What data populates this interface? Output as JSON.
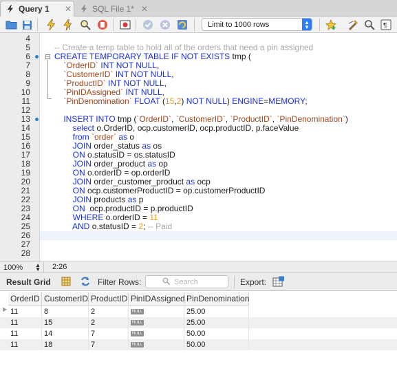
{
  "tabs": [
    {
      "label": "Query 1",
      "active": true,
      "close": "✕"
    },
    {
      "label": "SQL File 1*",
      "active": false,
      "close": "✕"
    }
  ],
  "toolbar": {
    "limit_value": "Limit to 1000 rows",
    "icons": [
      "folder-open-icon",
      "save-icon",
      "execute-icon",
      "execute-current-icon",
      "explain-icon",
      "stop-icon",
      "toggle-error-icon",
      "commit-icon",
      "rollback-icon",
      "autocommit-icon",
      "bookmark-icon",
      "beautify-icon",
      "find-icon",
      "invisible-chars-icon"
    ]
  },
  "editor": {
    "line_numbers": [
      "4",
      "5",
      "6",
      "7",
      "8",
      "9",
      "10",
      "11",
      "12",
      "13",
      "14",
      "15",
      "16",
      "17",
      "18",
      "19",
      "20",
      "21",
      "22",
      "23",
      "24",
      "25",
      "26",
      "27",
      "28"
    ],
    "comment_line": "-- Create a temp table to hold all of the orders that need a pin assigned"
  },
  "status": {
    "zoom": "100%",
    "cursor": "2:26"
  },
  "results": {
    "grid_label": "Result Grid",
    "filter_label": "Filter Rows:",
    "search_placeholder": "Search",
    "export_label": "Export:",
    "columns": [
      "OrderID",
      "CustomerID",
      "ProductID",
      "PinIDAssigned",
      "PinDenomination"
    ],
    "null_text": "NULL",
    "rows": [
      [
        "11",
        "8",
        "2",
        "NULL",
        "25.00"
      ],
      [
        "11",
        "15",
        "2",
        "NULL",
        "25.00"
      ],
      [
        "11",
        "14",
        "7",
        "NULL",
        "50.00"
      ],
      [
        "11",
        "18",
        "7",
        "NULL",
        "50.00"
      ]
    ]
  },
  "colors": {
    "keyword": "#1a2fd9",
    "identifier": "#a0461e",
    "number": "#e69a24",
    "comment": "#a9a9a9",
    "breakpoint": "#2b80d5"
  }
}
